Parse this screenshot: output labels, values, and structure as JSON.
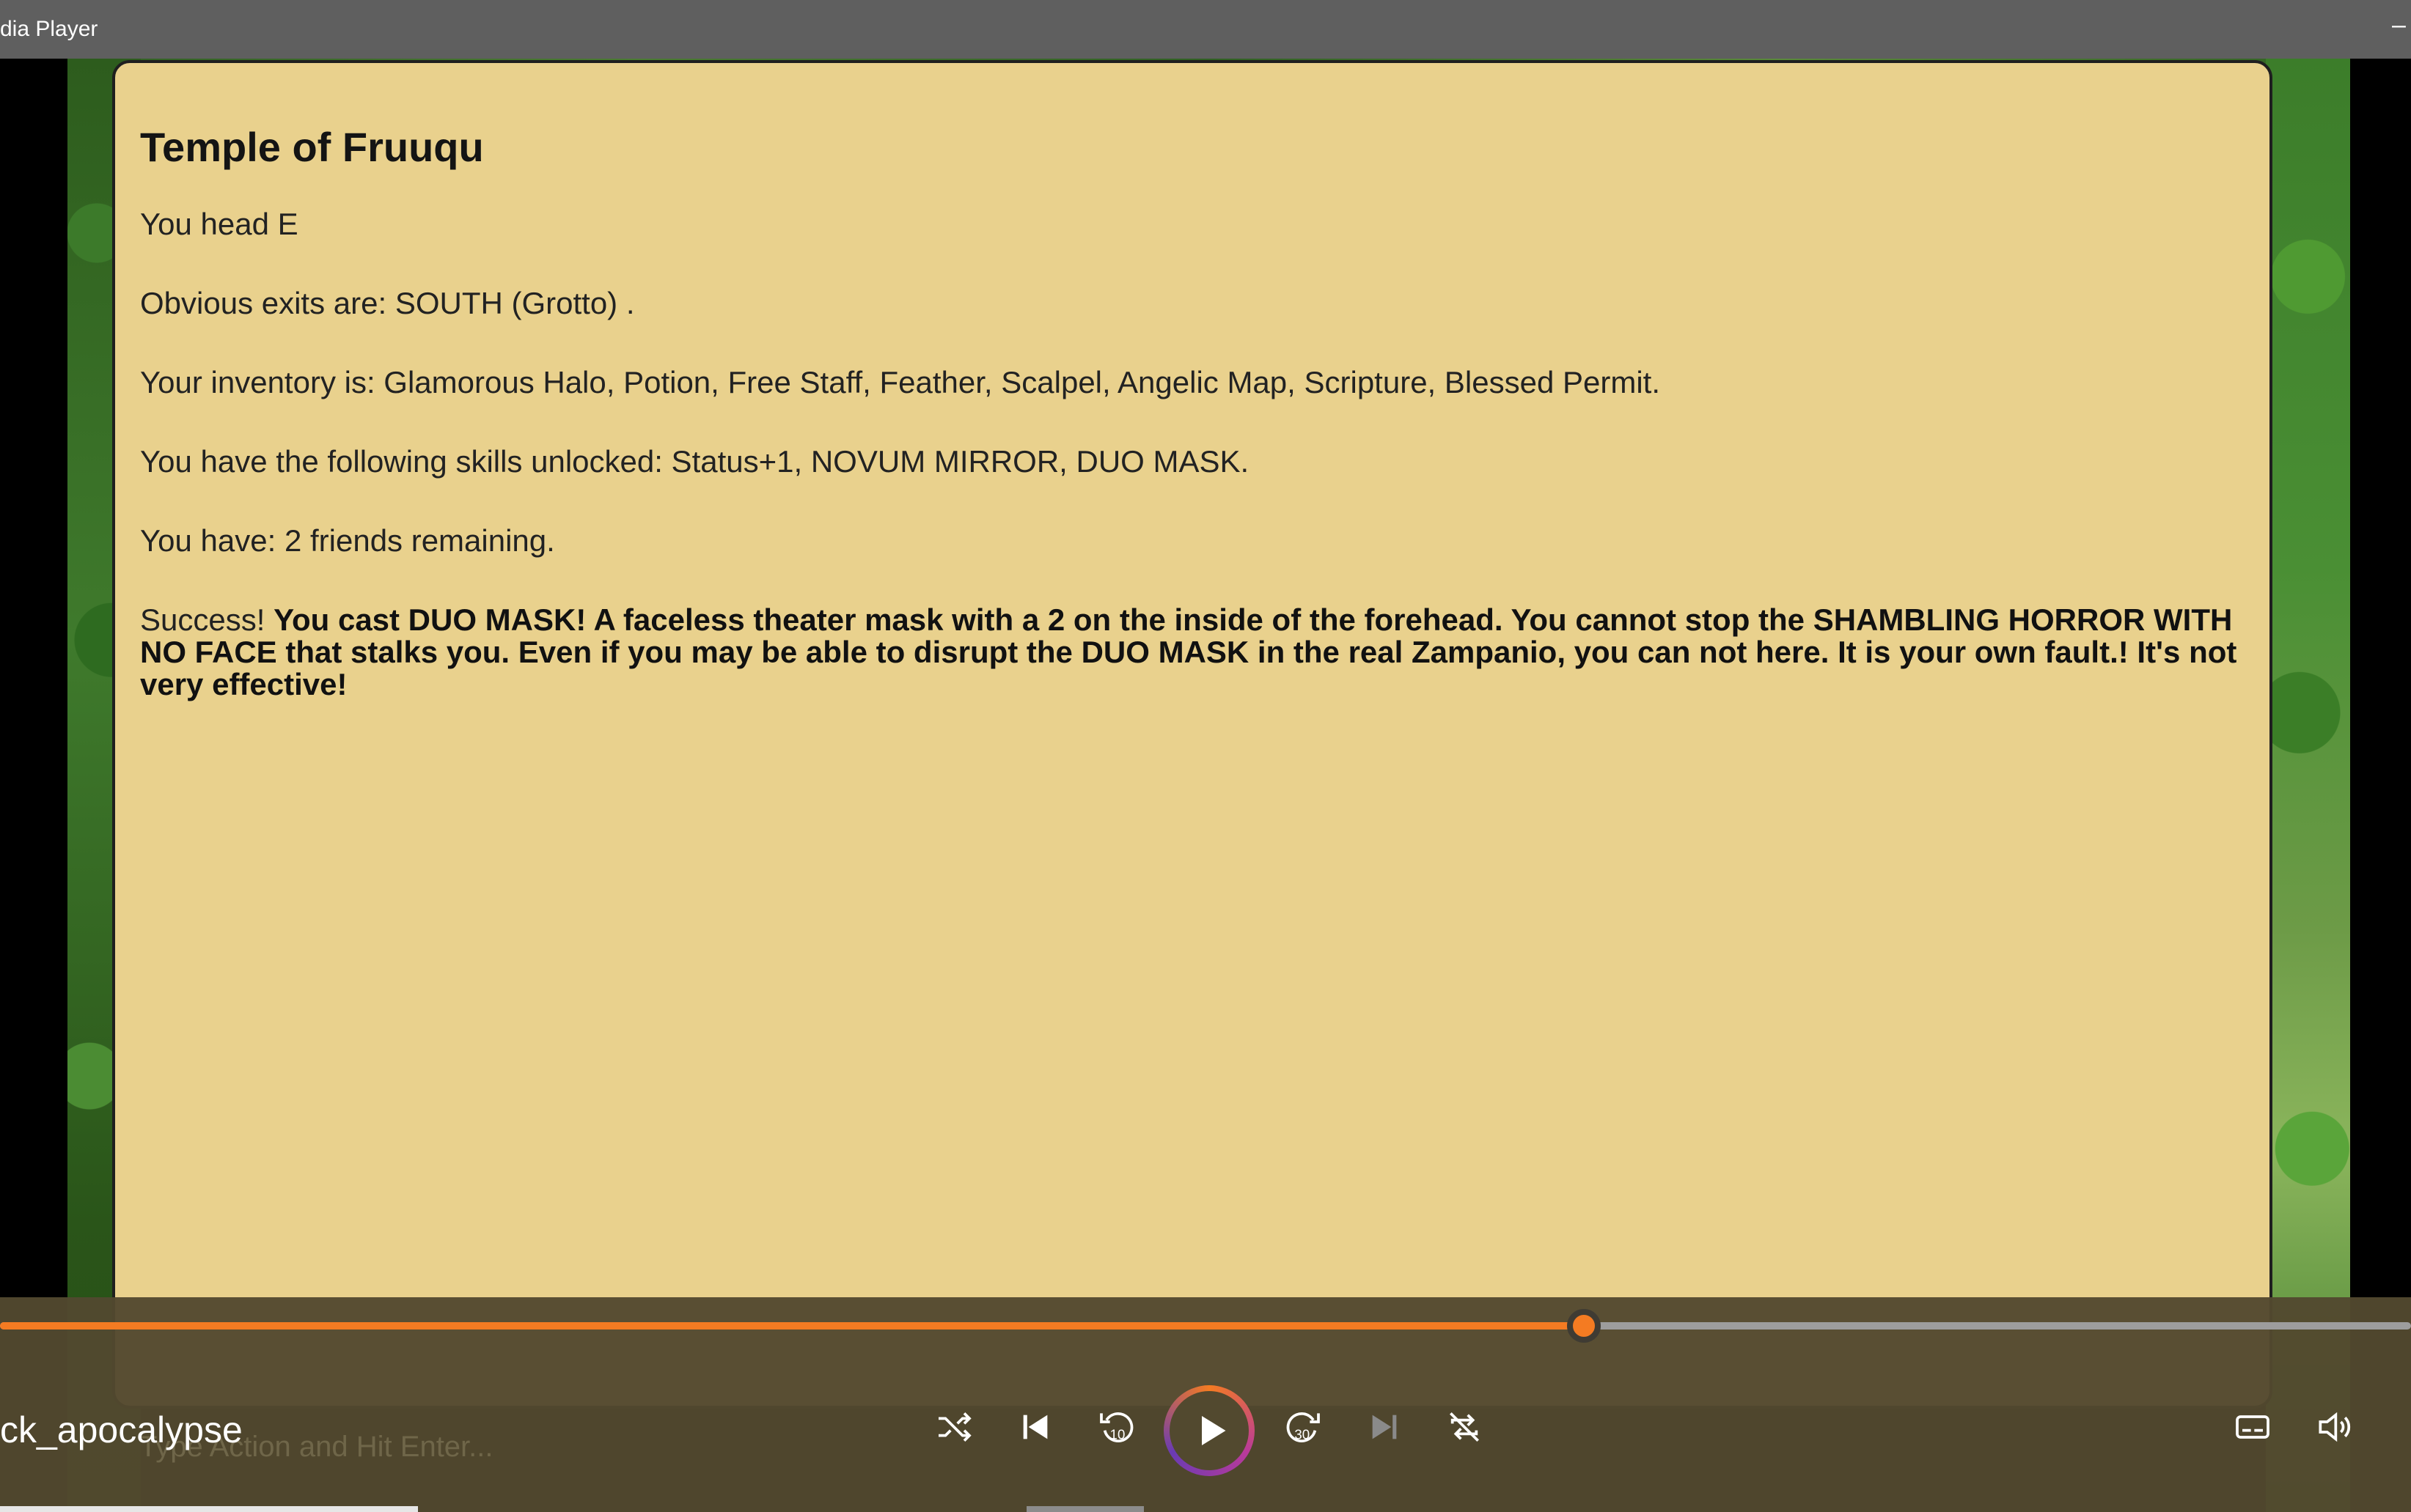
{
  "window": {
    "app_title": "dia Player",
    "minimize_glyph": "–"
  },
  "game": {
    "room_title": "Temple of Fruuqu",
    "head_line": "You head E",
    "exits_line": "Obvious exits are: SOUTH (Grotto) .",
    "inventory_line": "Your inventory is: Glamorous Halo, Potion, Free Staff, Feather, Scalpel, Angelic Map, Scripture, Blessed Permit.",
    "skills_line": "You have the following skills unlocked: Status+1, NOVUM MIRROR, DUO MASK.",
    "friends_line": "You have: 2 friends remaining.",
    "result_prefix": "Success! ",
    "result_text": "You cast DUO MASK! A faceless theater mask with a 2 on the inside of the forehead. You cannot stop the SHAMBLING HORROR WITH NO FACE that stalks you. Even if you may be able to disrupt the DUO MASK in the real Zampanio, you can not here. It is your own fault.! It's not very effective!",
    "input_placeholder": "Type Action and Hit Enter..."
  },
  "player": {
    "media_title": "ck_apocalypse",
    "progress_fraction": 0.657,
    "icons": {
      "shuffle": "shuffle-icon",
      "previous": "previous-icon",
      "rewind": "rewind-10-icon",
      "play": "play-icon",
      "forward": "forward-30-icon",
      "next": "next-icon",
      "repeat": "repeat-icon",
      "captions": "captions-icon",
      "volume": "volume-icon"
    },
    "rewind_label": "10",
    "forward_label": "30",
    "accent_color": "#f47b22"
  }
}
